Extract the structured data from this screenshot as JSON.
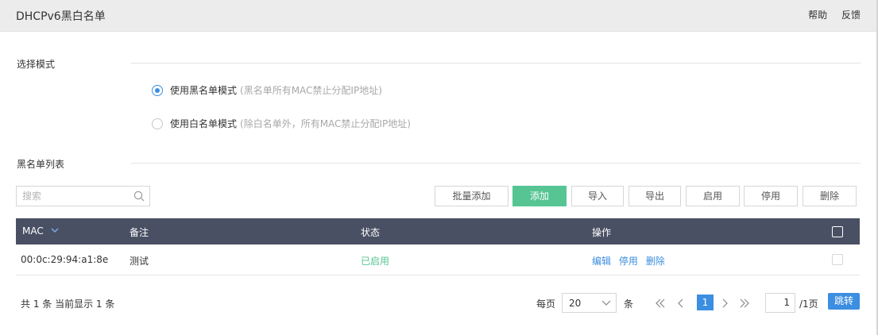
{
  "header": {
    "title": "DHCPv6黑白名单",
    "help": "帮助",
    "feedback": "反馈"
  },
  "mode": {
    "section_label": "选择模式",
    "options": [
      {
        "label": "使用黑名单模式",
        "hint": "(黑名单所有MAC禁止分配IP地址)",
        "checked": true
      },
      {
        "label": "使用白名单模式",
        "hint": "(除白名单外，所有MAC禁止分配IP地址)",
        "checked": false
      }
    ]
  },
  "list": {
    "section_label": "黑名单列表",
    "search_placeholder": "搜索",
    "buttons": {
      "batch_add": "批量添加",
      "add": "添加",
      "import": "导入",
      "export": "导出",
      "enable": "启用",
      "disable": "停用",
      "delete": "删除"
    },
    "columns": {
      "mac": "MAC",
      "remark": "备注",
      "status": "状态",
      "actions": "操作"
    },
    "rows": [
      {
        "mac": "00:0c:29:94:a1:8e",
        "remark": "测试",
        "status": "已启用",
        "actions": [
          "编辑",
          "停用",
          "删除"
        ]
      }
    ]
  },
  "pagination": {
    "summary": "共 1 条 当前显示 1 条",
    "per_page_label": "每页",
    "per_page_value": "20",
    "unit": "条",
    "current_page": "1",
    "jump_value": "1",
    "total_pages": "/1页",
    "jump_label": "跳转"
  },
  "colors": {
    "accent": "#3b8ee0",
    "primary_button": "#56c593",
    "status_enabled": "#56c593",
    "table_header": "#4a5064"
  }
}
